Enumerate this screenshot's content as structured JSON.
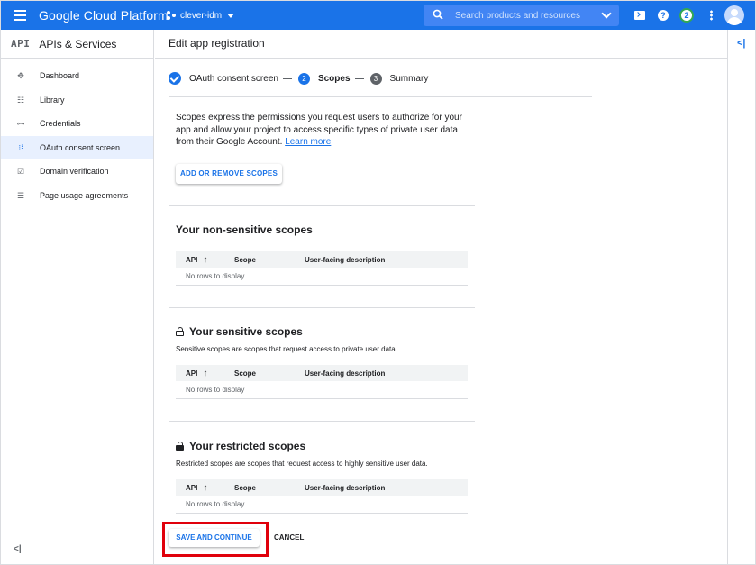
{
  "topbar": {
    "brand": "Google Cloud Platform",
    "project": "clever-idm",
    "search_placeholder": "Search products and resources",
    "notification_count": "2"
  },
  "sidebar": {
    "logo": "API",
    "title": "APIs & Services",
    "items": [
      {
        "label": "Dashboard",
        "icon": "dashboard-icon",
        "active": false
      },
      {
        "label": "Library",
        "icon": "library-icon",
        "active": false
      },
      {
        "label": "Credentials",
        "icon": "key-icon",
        "active": false
      },
      {
        "label": "OAuth consent screen",
        "icon": "consent-icon",
        "active": true
      },
      {
        "label": "Domain verification",
        "icon": "domain-verification-icon",
        "active": false
      },
      {
        "label": "Page usage agreements",
        "icon": "agreements-icon",
        "active": false
      }
    ]
  },
  "main": {
    "title": "Edit app registration",
    "steps": [
      {
        "label": "OAuth consent screen",
        "state": "done"
      },
      {
        "num": "2",
        "label": "Scopes",
        "state": "current"
      },
      {
        "num": "3",
        "label": "Summary",
        "state": "pending"
      }
    ],
    "description": "Scopes express the permissions you request users to authorize for your app and allow your project to access specific types of private user data from their Google Account.",
    "learn_more": "Learn more",
    "add_scopes_button": "ADD OR REMOVE SCOPES",
    "table_headers": {
      "api": "API",
      "scope": "Scope",
      "description": "User-facing description"
    },
    "empty_text": "No rows to display",
    "sections": {
      "non_sensitive": {
        "title": "Your non-sensitive scopes"
      },
      "sensitive": {
        "title": "Your sensitive scopes",
        "subtitle": "Sensitive scopes are scopes that request access to private user data."
      },
      "restricted": {
        "title": "Your restricted scopes",
        "subtitle": "Restricted scopes are scopes that request access to highly sensitive user data."
      }
    },
    "save_button": "SAVE AND CONTINUE",
    "cancel_button": "CANCEL"
  },
  "colors": {
    "brand_blue": "#1a73e8",
    "highlight_red": "#e0000b"
  }
}
